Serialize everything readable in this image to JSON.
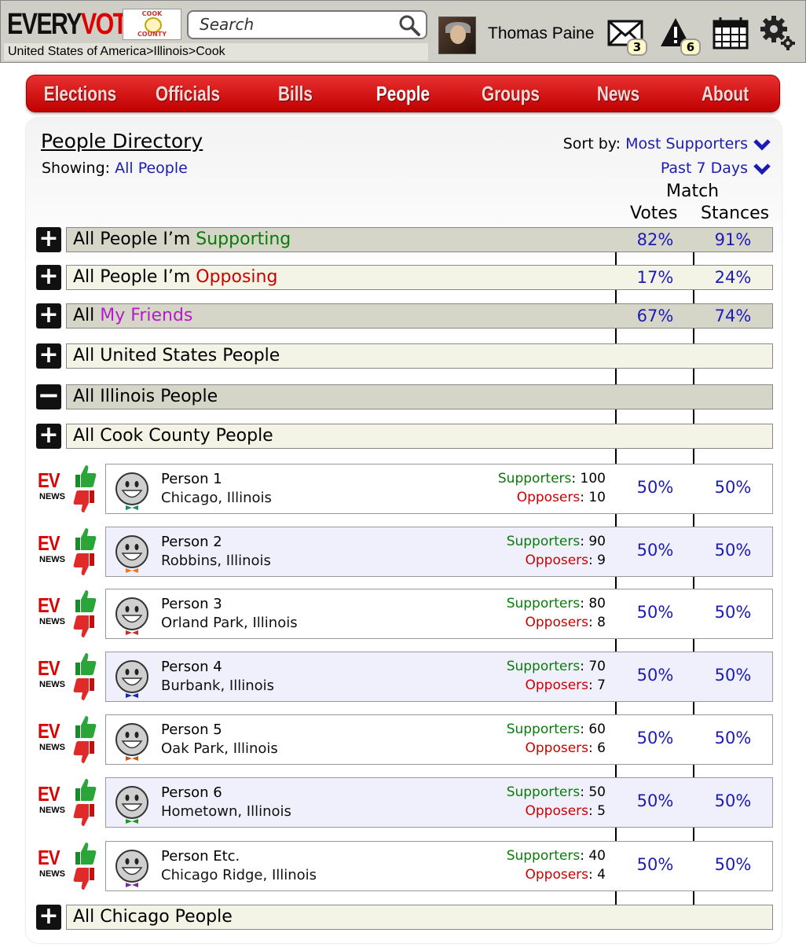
{
  "header": {
    "logo_every": "EVERY",
    "logo_vote": "VOTE",
    "county_top": "COOK",
    "county_bottom": "COUNTY",
    "breadcrumb": "United States of America>Illinois>Cook",
    "search_placeholder": "Search",
    "user_name": "Thomas Paine",
    "messages_count": "3",
    "alerts_count": "6"
  },
  "nav": {
    "tabs": [
      "Elections",
      "Officials",
      "Bills",
      "People",
      "Groups",
      "News",
      "About"
    ],
    "active": "People"
  },
  "directory": {
    "title": "People Directory",
    "showing_label": "Showing:",
    "showing_value": "All People",
    "sort_label": "Sort by:",
    "sort_value": "Most Supporters",
    "period_value": "Past 7 Days",
    "match_header": "Match",
    "votes_header": "Votes",
    "stances_header": "Stances"
  },
  "groups": [
    {
      "pre": "All People I’m ",
      "hl": "Supporting",
      "votes": "82%",
      "stances": "91%"
    },
    {
      "pre": "All People I’m ",
      "hl": "Opposing",
      "votes": "17%",
      "stances": "24%"
    },
    {
      "pre": "All ",
      "hl": "My Friends",
      "votes": "67%",
      "stances": "74%"
    },
    {
      "pre": "All United States People",
      "hl": "",
      "votes": "",
      "stances": ""
    },
    {
      "pre": "All Illinois People",
      "hl": "",
      "votes": "",
      "stances": ""
    },
    {
      "pre": "All Cook County People",
      "hl": "",
      "votes": "",
      "stances": ""
    }
  ],
  "people": [
    {
      "name": "Person 1",
      "location": "Chicago, Illinois",
      "supporters": "100",
      "opposers": "10",
      "votes": "50%",
      "stances": "50%",
      "tie_color": "#1a8a6a"
    },
    {
      "name": "Person 2",
      "location": "Robbins, Illinois",
      "supporters": "90",
      "opposers": "9",
      "votes": "50%",
      "stances": "50%",
      "tie_color": "#f07818"
    },
    {
      "name": "Person 3",
      "location": "Orland Park, Illinois",
      "supporters": "80",
      "opposers": "8",
      "votes": "50%",
      "stances": "50%",
      "tie_color": "#c0302a"
    },
    {
      "name": "Person 4",
      "location": "Burbank, Illinois",
      "supporters": "70",
      "opposers": "7",
      "votes": "50%",
      "stances": "50%",
      "tie_color": "#1a2aa0"
    },
    {
      "name": "Person 5",
      "location": "Oak Park, Illinois",
      "supporters": "60",
      "opposers": "6",
      "votes": "50%",
      "stances": "50%",
      "tie_color": "#c05a1a"
    },
    {
      "name": "Person 6",
      "location": "Hometown, Illinois",
      "supporters": "50",
      "opposers": "5",
      "votes": "50%",
      "stances": "50%",
      "tie_color": "#1a9a1a"
    },
    {
      "name": "Person Etc.",
      "location": "Chicago Ridge, Illinois",
      "supporters": "40",
      "opposers": "4",
      "votes": "50%",
      "stances": "50%",
      "tie_color": "#7a2a9a"
    }
  ],
  "labels": {
    "supporters": "Supporters",
    "opposers": "Opposers",
    "ev": "EV",
    "news": "NEWS"
  },
  "footer_group": {
    "label": "All Chicago People"
  },
  "colors": {
    "nav_red": "#d41a1a",
    "link_blue": "#1c1cb5",
    "support_green": "#0a7a0a",
    "oppose_red": "#c00000",
    "friends_purple": "#b51cc9"
  }
}
